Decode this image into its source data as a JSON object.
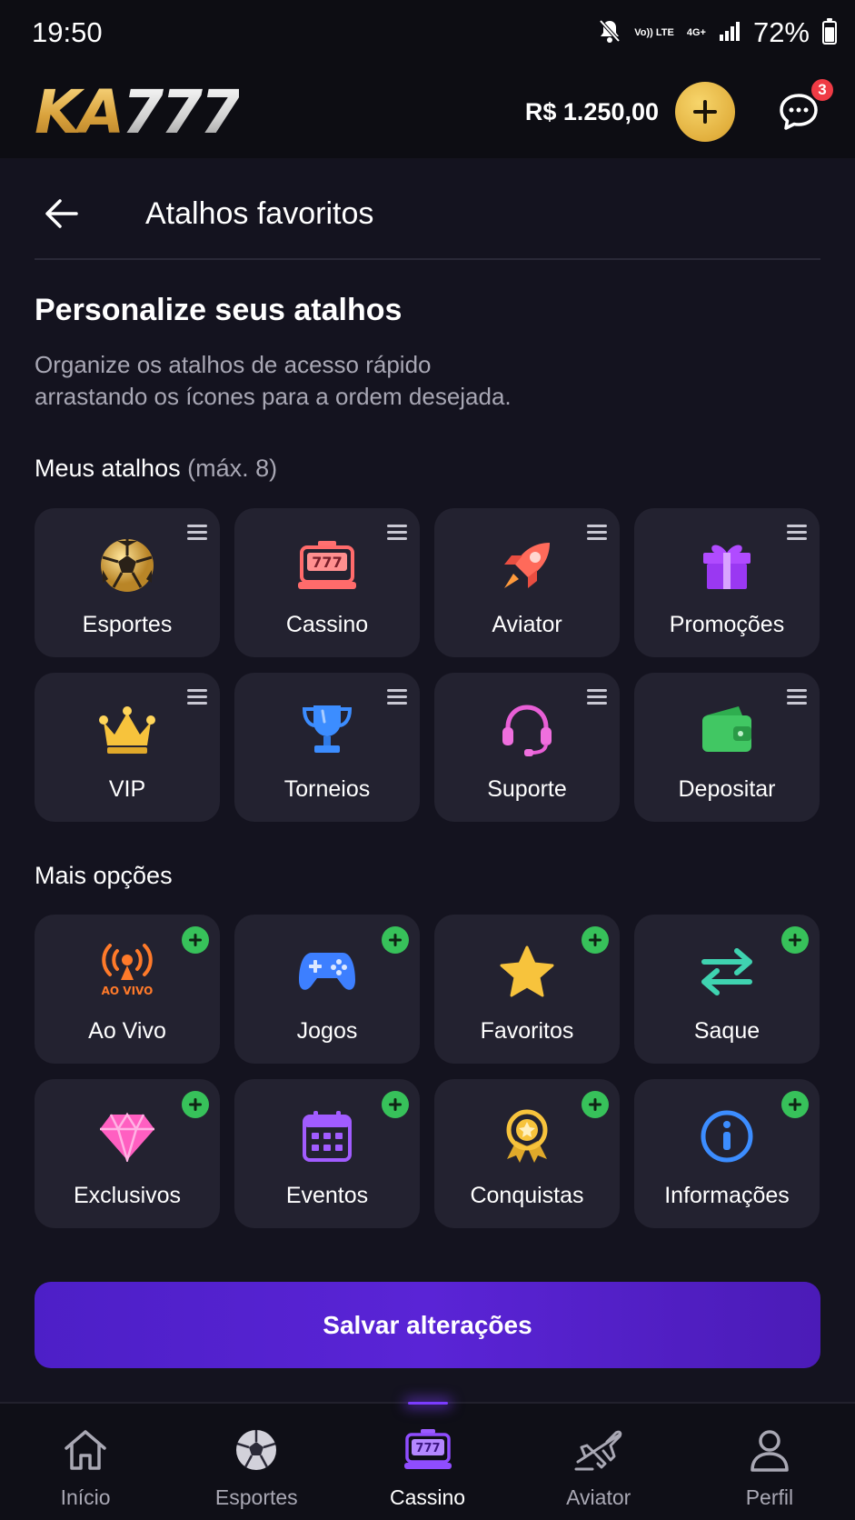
{
  "status_bar": {
    "time": "19:50",
    "net_top": "Vo)) LTE",
    "net_gen": "4G+",
    "battery": "72%"
  },
  "header": {
    "logo_ka": "KA",
    "logo_num": "777",
    "balance": "R$ 1.250,00",
    "chat_badge": "3"
  },
  "page": {
    "title": "Atalhos favoritos",
    "section_title": "Personalize seus atalhos",
    "section_desc_line1": "Organize os atalhos de acesso rápido",
    "section_desc_line2": "arrastando os ícones para a ordem desejada.",
    "my_label": "Meus atalhos",
    "my_label_hint": "(máx. 8)",
    "more_label": "Mais opções",
    "save_label": "Salvar alterações"
  },
  "my_shortcuts": [
    {
      "label": "Esportes",
      "icon": "soccer-ball-icon"
    },
    {
      "label": "Cassino",
      "icon": "slot-machine-icon"
    },
    {
      "label": "Aviator",
      "icon": "rocket-icon"
    },
    {
      "label": "Promoções",
      "icon": "gift-icon"
    },
    {
      "label": "VIP",
      "icon": "crown-icon"
    },
    {
      "label": "Torneios",
      "icon": "trophy-icon"
    },
    {
      "label": "Suporte",
      "icon": "headset-icon"
    },
    {
      "label": "Depositar",
      "icon": "wallet-icon"
    }
  ],
  "more_options": [
    {
      "label": "Ao Vivo",
      "icon": "live-broadcast-icon",
      "icon_text": "AO VIVO"
    },
    {
      "label": "Jogos",
      "icon": "gamepad-icon"
    },
    {
      "label": "Favoritos",
      "icon": "star-icon"
    },
    {
      "label": "Saque",
      "icon": "transfer-arrows-icon"
    },
    {
      "label": "Exclusivos",
      "icon": "diamond-icon"
    },
    {
      "label": "Eventos",
      "icon": "calendar-icon"
    },
    {
      "label": "Conquistas",
      "icon": "medal-icon"
    },
    {
      "label": "Informações",
      "icon": "info-icon"
    }
  ],
  "bottom_nav": [
    {
      "label": "Início",
      "icon": "home-icon"
    },
    {
      "label": "Esportes",
      "icon": "soccer-ball-icon"
    },
    {
      "label": "Cassino",
      "icon": "slot-machine-icon",
      "active": true
    },
    {
      "label": "Aviator",
      "icon": "airplane-icon"
    },
    {
      "label": "Perfil",
      "icon": "user-icon"
    }
  ],
  "colors": {
    "background": "#14131f",
    "tile": "#232230",
    "accent_purple": "#5a24d6",
    "gold": "#e2b03e",
    "add_green": "#37c15a",
    "badge_red": "#ef3b45"
  }
}
